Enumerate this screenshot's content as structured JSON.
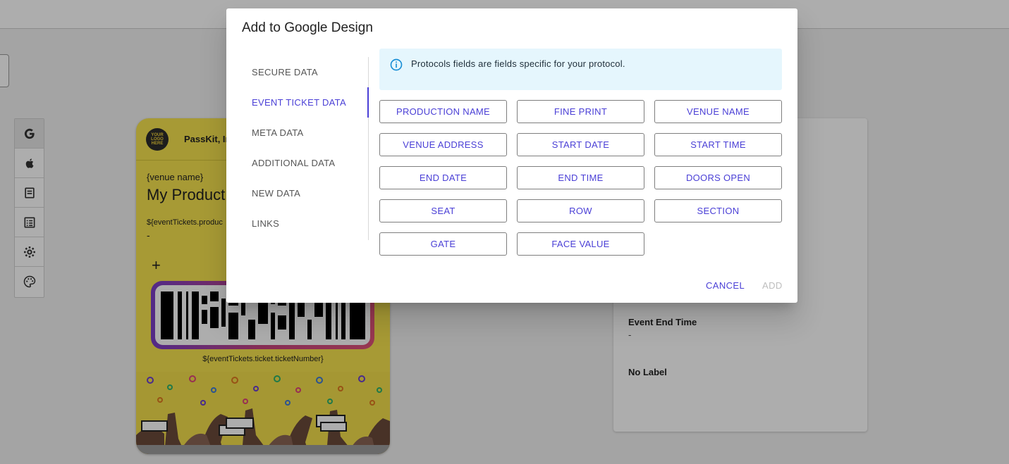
{
  "background": {
    "pass": {
      "logo_text": "YOUR LOGO HERE",
      "org_name": "PassKit, In",
      "venue": "{venue name}",
      "title": "My Product",
      "field_label": "${eventTickets.produc",
      "field_value": "-",
      "plus": "+",
      "ticket_number": "${eventTickets.ticket.ticketNumber}"
    },
    "details": {
      "end_time_label": "Event End Time",
      "end_time_value": "-",
      "no_label": "No Label"
    },
    "toolbar_icons": [
      "google-icon",
      "apple-icon",
      "document-icon",
      "list-icon",
      "gear-icon",
      "palette-icon"
    ]
  },
  "dialog": {
    "title": "Add to Google Design",
    "tabs": [
      {
        "label": "SECURE DATA",
        "active": false
      },
      {
        "label": "EVENT TICKET DATA",
        "active": true
      },
      {
        "label": "META DATA",
        "active": false
      },
      {
        "label": "ADDITIONAL DATA",
        "active": false
      },
      {
        "label": "NEW DATA",
        "active": false
      },
      {
        "label": "LINKS",
        "active": false
      }
    ],
    "info": "Protocols fields are fields specific for your protocol.",
    "fields": [
      "PRODUCTION NAME",
      "FINE PRINT",
      "VENUE NAME",
      "VENUE ADDRESS",
      "START DATE",
      "START TIME",
      "END DATE",
      "END TIME",
      "DOORS OPEN",
      "SEAT",
      "ROW",
      "SECTION",
      "GATE",
      "FACE VALUE"
    ],
    "cancel_label": "CANCEL",
    "add_label": "ADD",
    "accent_color": "#4a3fd6",
    "info_bg_color": "#e5f6fd"
  }
}
